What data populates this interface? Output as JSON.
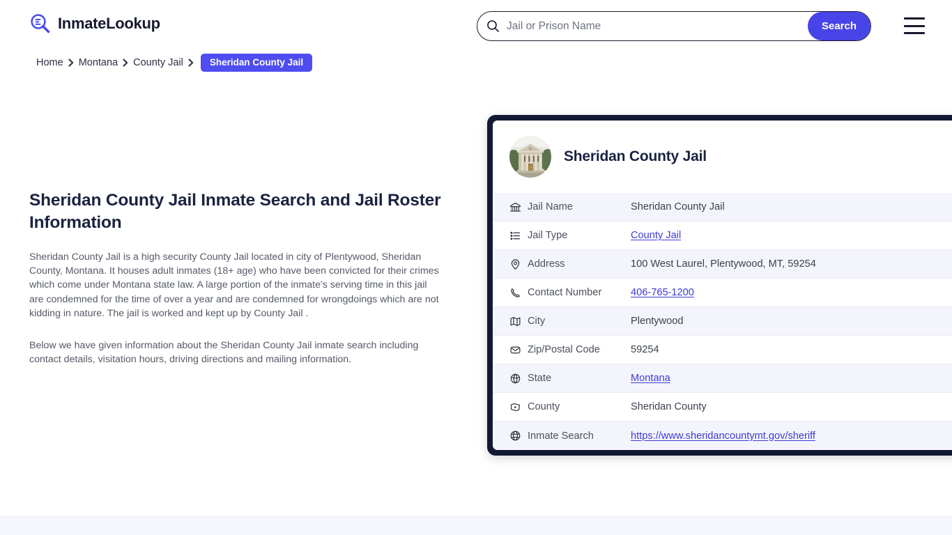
{
  "header": {
    "logo_text": "InmateLookup",
    "logo_icon": "magnifier-list-icon",
    "menu_icon": "hamburger-menu-icon"
  },
  "search": {
    "placeholder": "Jail or Prison Name",
    "value": "",
    "button_label": "Search",
    "icon": "search-icon",
    "accent_color": "#4744e8"
  },
  "breadcrumb": {
    "items": [
      {
        "label": "Home"
      },
      {
        "label": "Montana"
      },
      {
        "label": "County Jail"
      }
    ],
    "current": "Sheridan County Jail",
    "separator": "❯",
    "badge_color": "#4f4df0"
  },
  "main": {
    "title": "Sheridan County Jail Inmate Search and Jail Roster Information",
    "paragraph_1": "Sheridan County Jail is a high security County Jail located in city of Plentywood, Sheridan County, Montana. It houses adult inmates (18+ age) who have been convicted for their crimes which come under Montana state law. A large portion of the inmate's serving time in this jail are condemned for the time of over a year and are condemned for wrongdoings which are not kidding in nature. The jail is worked and kept up by County Jail .",
    "paragraph_2": "Below we have given information about the Sheridan County Jail inmate search including contact details, visitation hours, driving directions and mailing information."
  },
  "card": {
    "title": "Sheridan County Jail",
    "avatar_icon": "courthouse-building-photo",
    "border_color": "#111a32",
    "rows": [
      {
        "icon": "bank-icon",
        "label": "Jail Name",
        "value": "Sheridan County Jail",
        "link": false
      },
      {
        "icon": "list-icon",
        "label": "Jail Type",
        "value": "County Jail",
        "link": true
      },
      {
        "icon": "map-pin-icon",
        "label": "Address",
        "value": "100 West Laurel, Plentywood, MT, 59254",
        "link": false
      },
      {
        "icon": "phone-icon",
        "label": "Contact Number",
        "value": "406-765-1200",
        "link": true
      },
      {
        "icon": "map-icon",
        "label": "City",
        "value": "Plentywood",
        "link": false
      },
      {
        "icon": "envelope-icon",
        "label": "Zip/Postal Code",
        "value": "59254",
        "link": false
      },
      {
        "icon": "globe-grid-icon",
        "label": "State",
        "value": "Montana",
        "link": true
      },
      {
        "icon": "county-icon",
        "label": "County",
        "value": "Sheridan County",
        "link": false
      },
      {
        "icon": "web-icon",
        "label": "Inmate Search",
        "value": "https://www.sheridancountymt.gov/sheriff",
        "link": true
      }
    ]
  }
}
